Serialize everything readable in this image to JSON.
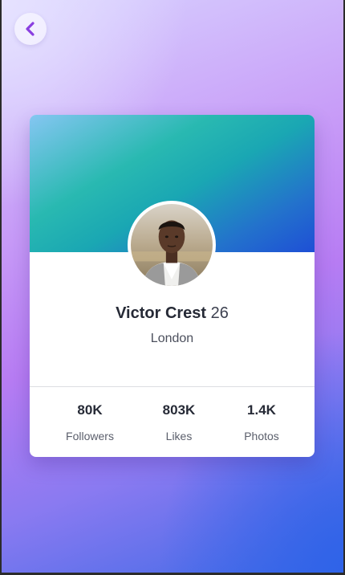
{
  "colors": {
    "accent": "#8a3fe0",
    "card": "#ffffff",
    "cover_start": "#85c6f2",
    "cover_end": "#1e4fd6"
  },
  "icons": {
    "back": "chevron-left-icon"
  },
  "profile": {
    "name": "Victor Crest",
    "age": "26",
    "location": "London"
  },
  "stats": [
    {
      "value": "80K",
      "label": "Followers"
    },
    {
      "value": "803K",
      "label": "Likes"
    },
    {
      "value": "1.4K",
      "label": "Photos"
    }
  ]
}
